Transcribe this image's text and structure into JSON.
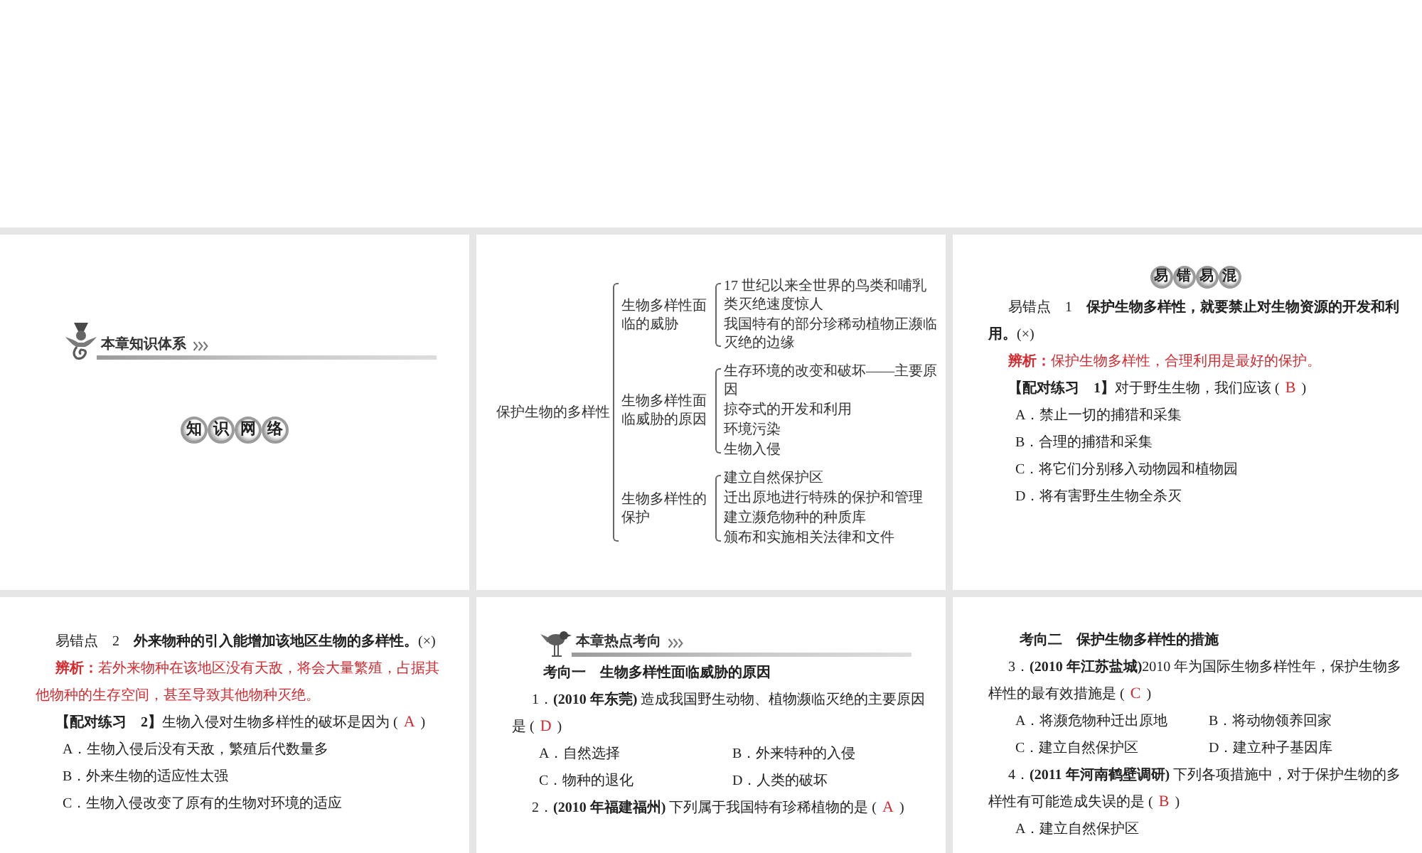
{
  "slides": [
    {
      "kind": "title",
      "banner": {
        "label": "本章知识体系"
      },
      "seal": [
        "知",
        "识",
        "网",
        "络"
      ]
    },
    {
      "kind": "tree",
      "tree": {
        "label": "保护生物的多样性",
        "children": [
          {
            "label": "生物多样性面临的威胁",
            "children": [
              {
                "label": "17 世纪以来全世界的鸟类和哺乳类灭绝速度惊人"
              },
              {
                "label": "我国特有的部分珍稀动植物正濒临灭绝的边缘"
              }
            ]
          },
          {
            "label": "生物多样性面临威胁的原因",
            "children": [
              {
                "label": "生存环境的改变和破坏——主要原因"
              },
              {
                "label": "掠夺式的开发和利用"
              },
              {
                "label": "环境污染"
              },
              {
                "label": "生物入侵"
              }
            ]
          },
          {
            "label": "生物多样性的保护",
            "children": [
              {
                "label": "建立自然保护区"
              },
              {
                "label": "迁出原地进行特殊的保护和管理"
              },
              {
                "label": "建立濒危物种的种质库"
              },
              {
                "label": "颁布和实施相关法律和文件"
              }
            ]
          }
        ]
      }
    },
    {
      "kind": "exercise",
      "seal": [
        "易",
        "错",
        "易",
        "混"
      ],
      "blocks": [
        {
          "kind": "point",
          "text": "易错点　1　**保护生物多样性，就要禁止对生物资源的开发和利用。**(×)"
        },
        {
          "kind": "analysis",
          "text": "**辨析：**保护生物多样性，合理利用是最好的保护。"
        },
        {
          "kind": "question",
          "text": "**【配对练习　1】**对于野生生物，我们应该 (",
          "answer": "B",
          "close": ")"
        },
        {
          "kind": "options",
          "items": [
            "A．禁止一切的捕猎和采集",
            "B．合理的捕猎和采集",
            "C．将它们分别移入动物园和植物园",
            "D．将有害野生生物全杀灭"
          ]
        }
      ]
    },
    {
      "kind": "exercise",
      "blocks": [
        {
          "kind": "point",
          "text": "易错点　2　**外来物种的引入能增加该地区生物的多样性。**(×)"
        },
        {
          "kind": "analysis",
          "text": "**辨析：**若外来物种在该地区没有天敌，将会大量繁殖，占据其他物种的生存空间，甚至导致其他物种灭绝。"
        },
        {
          "kind": "question",
          "text": "**【配对练习　2】**生物入侵对生物多样性的破坏是因为 (",
          "answer": "A",
          "close": ")"
        },
        {
          "kind": "options",
          "items": [
            "A．生物入侵后没有天敌，繁殖后代数量多",
            "B．外来生物的适应性太强",
            "C．生物入侵改变了原有的生物对环境的适应"
          ]
        }
      ]
    },
    {
      "kind": "exercise",
      "banner": {
        "label": "本章热点考向"
      },
      "blocks": [
        {
          "kind": "heading",
          "text": "考向一　生物多样性面临威胁的原因"
        },
        {
          "kind": "question",
          "text": "1．**(2010 年东莞)** 造成我国野生动物、植物濒临灭绝的主要原因是 (",
          "answer": "D",
          "close": ")"
        },
        {
          "kind": "option-grid",
          "items": [
            "A．自然选择",
            "B．外来特种的入侵",
            "C．物种的退化",
            "D．人类的破坏"
          ]
        },
        {
          "kind": "question",
          "text": "2．**(2010 年福建福州)** 下列属于我国特有珍稀植物的是 (",
          "answer": "A",
          "close": ")"
        }
      ]
    },
    {
      "kind": "exercise",
      "blocks": [
        {
          "kind": "heading",
          "text": "考向二　保护生物多样性的措施"
        },
        {
          "kind": "question",
          "text": "3．**(2010 年江苏盐城)**2010 年为国际生物多样性年，保护生物多样性的最有效措施是 (",
          "answer": "C",
          "close": ")"
        },
        {
          "kind": "option-grid",
          "items": [
            "A．将濒危物种迁出原地",
            "B．将动物领养回家",
            "C．建立自然保护区",
            "D．建立种子基因库"
          ]
        },
        {
          "kind": "question",
          "text": "4．**(2011 年河南鹤壁调研)** 下列各项措施中，对于保护生物的多样性有可能造成失误的是 (",
          "answer": "B",
          "close": ")"
        },
        {
          "kind": "options",
          "items": [
            "A．建立自然保护区"
          ]
        }
      ]
    }
  ]
}
